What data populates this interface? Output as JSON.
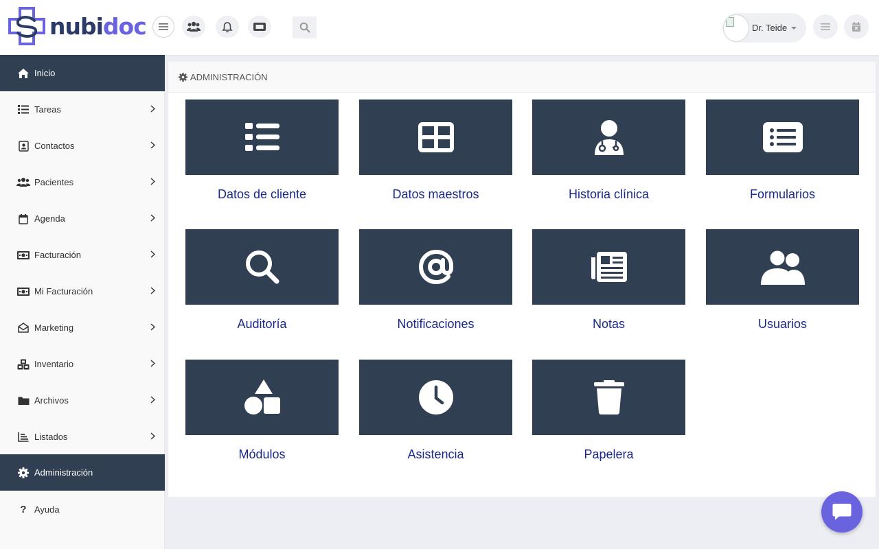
{
  "brand": {
    "name_part1": "nubi",
    "name_part2": "doc",
    "primary_color": "#6a63e0",
    "dark_color": "#313f52",
    "link_color": "#1a2a8a"
  },
  "topbar": {
    "icons": [
      "users-icon",
      "bell-icon",
      "ticket-icon",
      "search-icon"
    ],
    "user": {
      "name": "Dr. Teide"
    },
    "right_icons": [
      "list-icon",
      "calendar-x-icon"
    ]
  },
  "sidebar": {
    "items": [
      {
        "label": "Inicio",
        "icon": "home-icon",
        "active": true
      },
      {
        "label": "Tareas",
        "icon": "list-icon",
        "active": false
      },
      {
        "label": "Contactos",
        "icon": "address-book-icon",
        "active": false
      },
      {
        "label": "Pacientes",
        "icon": "users-icon",
        "active": false
      },
      {
        "label": "Agenda",
        "icon": "calendar-icon",
        "active": false
      },
      {
        "label": "Facturación",
        "icon": "money-icon",
        "active": false
      },
      {
        "label": "Mi Facturación",
        "icon": "money-icon",
        "active": false
      },
      {
        "label": "Marketing",
        "icon": "envelope-open-icon",
        "active": false
      },
      {
        "label": "Inventario",
        "icon": "cubes-icon",
        "active": false
      },
      {
        "label": "Archivos",
        "icon": "folder-icon",
        "active": false
      },
      {
        "label": "Listados",
        "icon": "chart-icon",
        "active": false
      },
      {
        "label": "Administración",
        "icon": "gear-icon",
        "active": true
      },
      {
        "label": "Ayuda",
        "icon": "question-icon",
        "active": false
      }
    ]
  },
  "main": {
    "section_title": "ADMINISTRACIÓN",
    "tiles": [
      {
        "label": "Datos de cliente",
        "icon": "list-ul-icon"
      },
      {
        "label": "Datos maestros",
        "icon": "grid-icon"
      },
      {
        "label": "Historia clínica",
        "icon": "doctor-icon"
      },
      {
        "label": "Formularios",
        "icon": "list-alt-icon"
      },
      {
        "label": "Auditoría",
        "icon": "search-icon"
      },
      {
        "label": "Notificaciones",
        "icon": "at-icon"
      },
      {
        "label": "Notas",
        "icon": "newspaper-icon"
      },
      {
        "label": "Usuarios",
        "icon": "users-icon"
      },
      {
        "label": "Módulos",
        "icon": "shapes-icon"
      },
      {
        "label": "Asistencia",
        "icon": "clock-icon"
      },
      {
        "label": "Papelera",
        "icon": "trash-icon"
      }
    ]
  },
  "chat": {
    "icon": "chat-icon"
  }
}
